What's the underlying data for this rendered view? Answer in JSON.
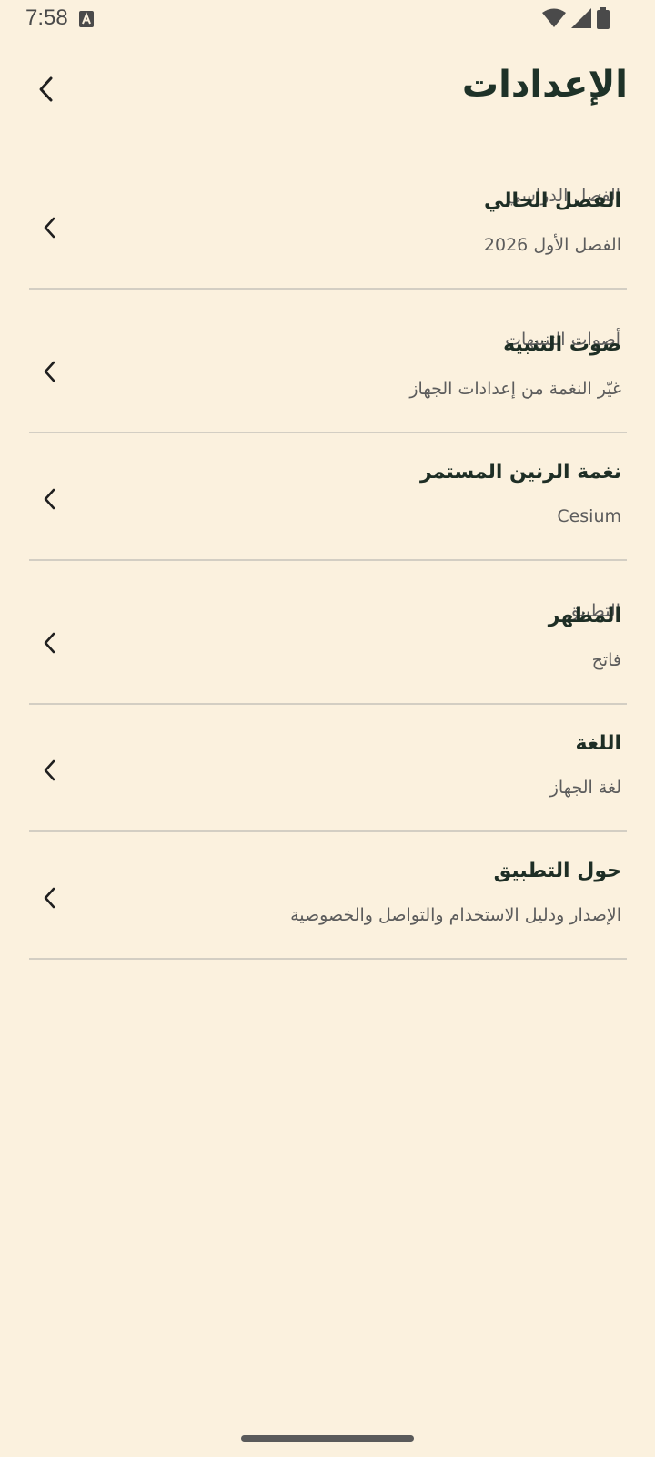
{
  "status_bar": {
    "time": "7:58",
    "icons": [
      "text-a-icon",
      "wifi-icon",
      "signal-icon",
      "battery-icon"
    ]
  },
  "app_bar": {
    "title": "الإعدادات",
    "back_icon": "chevron-left-icon"
  },
  "sections": {
    "term": {
      "header": "الفصل الدراسي",
      "items": [
        {
          "title": "الفصل الحالي",
          "subtitle": "الفصل الأول 2026"
        }
      ]
    },
    "sounds": {
      "header": "أصوات التنبيهات",
      "items": [
        {
          "title": "صوت التنبيه",
          "subtitle": "غيّر النغمة من إعدادات الجهاز"
        },
        {
          "title": "نغمة الرنين المستمر",
          "subtitle": "Cesium"
        }
      ]
    },
    "app": {
      "header": "التطبيق",
      "items": [
        {
          "title": "المظهر",
          "subtitle": "فاتح"
        },
        {
          "title": "اللغة",
          "subtitle": "لغة الجهاز"
        },
        {
          "title": "حول التطبيق",
          "subtitle": "الإصدار ودليل الاستخدام والتواصل والخصوصية"
        }
      ]
    }
  },
  "colors": {
    "background": "#FBF1DE",
    "title_text": "#1E3228",
    "secondary_text": "#5C5C5C",
    "divider": "#D3CEC3"
  }
}
